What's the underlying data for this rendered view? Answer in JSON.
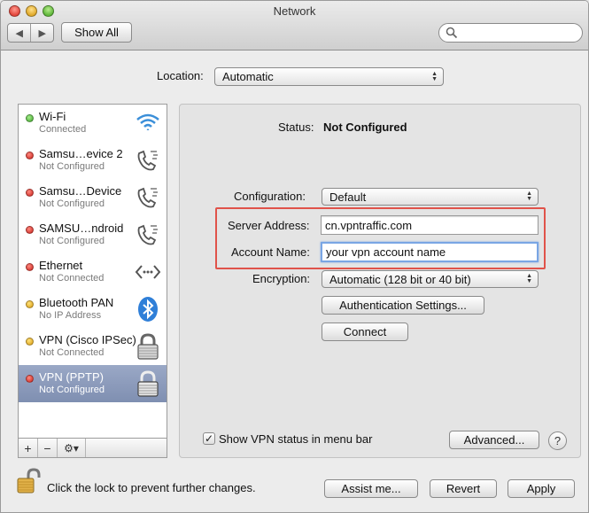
{
  "window": {
    "title": "Network"
  },
  "toolbar": {
    "back": "◀",
    "forward": "▶",
    "show_all": "Show All",
    "search_placeholder": ""
  },
  "location": {
    "label": "Location:",
    "value": "Automatic"
  },
  "services": [
    {
      "name": "Wi-Fi",
      "status": "Connected",
      "dot": "green",
      "icon": "wifi-icon"
    },
    {
      "name": "Samsu…evice 2",
      "status": "Not Configured",
      "dot": "red",
      "icon": "phone-icon"
    },
    {
      "name": "Samsu…Device",
      "status": "Not Configured",
      "dot": "red",
      "icon": "phone-icon"
    },
    {
      "name": "SAMSU…ndroid",
      "status": "Not Configured",
      "dot": "red",
      "icon": "phone-icon"
    },
    {
      "name": "Ethernet",
      "status": "Not Connected",
      "dot": "red",
      "icon": "ethernet-icon"
    },
    {
      "name": "Bluetooth PAN",
      "status": "No IP Address",
      "dot": "yellow",
      "icon": "bluetooth-icon"
    },
    {
      "name": "VPN (Cisco IPSec)",
      "status": "Not Connected",
      "dot": "yellow",
      "icon": "lock-icon"
    },
    {
      "name": "VPN (PPTP)",
      "status": "Not Configured",
      "dot": "red",
      "icon": "lock-icon",
      "selected": true
    }
  ],
  "sidebar_bottom": {
    "add": "+",
    "remove": "−",
    "gear": "⚙▾"
  },
  "detail": {
    "status_label": "Status:",
    "status_value": "Not Configured",
    "configuration_label": "Configuration:",
    "configuration_value": "Default",
    "server_label": "Server Address:",
    "server_value": "cn.vpntraffic.com",
    "account_label": "Account Name:",
    "account_value": "your vpn account name",
    "encryption_label": "Encryption:",
    "encryption_value": "Automatic (128 bit or 40 bit)",
    "auth_button": "Authentication Settings...",
    "connect_button": "Connect",
    "show_vpn_status": "Show VPN status in menu bar",
    "show_vpn_checked": "✓",
    "advanced_button": "Advanced...",
    "help": "?"
  },
  "footer": {
    "lock_text": "Click the lock to prevent further changes.",
    "assist_button": "Assist me...",
    "revert_button": "Revert",
    "apply_button": "Apply"
  },
  "colors": {
    "highlight": "#e0534a",
    "selected_row": "#8a98b8",
    "focus_ring": "#7aa6e4"
  }
}
